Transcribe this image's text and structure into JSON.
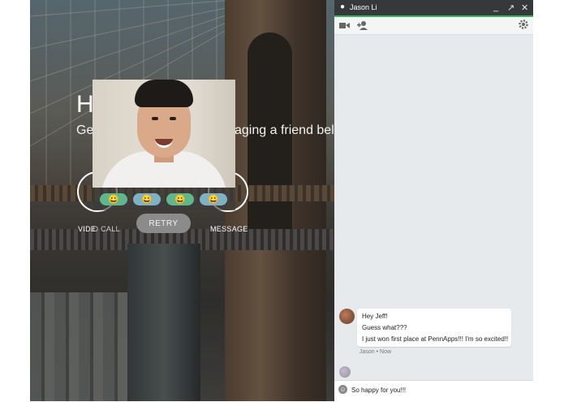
{
  "background_app": {
    "heading": "H",
    "subtitle_left": "Get",
    "subtitle_right": "aging a friend below",
    "actions": {
      "video_call_label_left": "VIDE",
      "video_call_label_right": "O CALL",
      "message_label": "MESSAGE"
    }
  },
  "video_overlay": {
    "emoji_buttons": [
      {
        "glyph": "😀",
        "color": "#5fb88d"
      },
      {
        "glyph": "😀",
        "color": "#7fb1c4"
      },
      {
        "glyph": "😀",
        "color": "#5fb88d"
      },
      {
        "glyph": "😀",
        "color": "#7fb1c4"
      }
    ],
    "retry_label": "RETRY"
  },
  "chat": {
    "window_title": "Jason Li",
    "window_controls": {
      "minimize": "_",
      "popout": "↗",
      "close": "✕"
    },
    "toolbar": {
      "video_icon": "video-camera-icon",
      "add_person_icon": "add-person-icon",
      "settings_icon": "gear-icon"
    },
    "messages": [
      {
        "lines": [
          "Hey Jeff!",
          "Guess what???",
          "I just won first place at PennApps!!! I'm so excited!!"
        ],
        "meta": "Jason • Now"
      }
    ],
    "input_value": "So happy for you!!!"
  },
  "colors": {
    "title_bar": "#36393b",
    "accent_green": "#3fb55b",
    "chat_bg": "#e7eaec"
  }
}
